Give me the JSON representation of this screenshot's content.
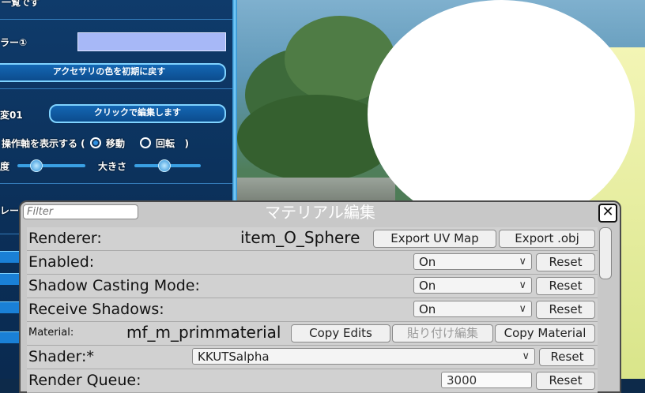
{
  "left_panel": {
    "top_label": "一覧です",
    "color_label": "ラー①",
    "reset_accessory_button": "アクセサリの色を初期に戻す",
    "edit_label": "変01",
    "edit_button": "クリックで編集します",
    "show_axis_label": "操作軸を表示する (",
    "move_label": "移動",
    "rotate_label": "回転",
    "close_paren": ")",
    "speed_label": "度",
    "size_label": "大きさ",
    "row_label": "レー",
    "swatch_color": "#a7b8f7"
  },
  "editor": {
    "title": "マテリアル編集",
    "filter_placeholder": "Filter",
    "close_glyph": "✕",
    "renderer_label": "Renderer:",
    "renderer_value": "item_O_Sphere",
    "export_uv": "Export UV Map",
    "export_obj": "Export .obj",
    "enabled_label": "Enabled:",
    "enabled_value": "On",
    "shadow_cast_label": "Shadow Casting Mode:",
    "shadow_cast_value": "On",
    "receive_label": "Receive Shadows:",
    "receive_value": "On",
    "material_label": "Material:",
    "material_value": "mf_m_primmaterial",
    "copy_edits": "Copy Edits",
    "paste_edits": "貼り付け編集",
    "copy_material": "Copy Material",
    "shader_label": "Shader:*",
    "shader_value": "KKUTSalpha",
    "queue_label": "Render Queue:",
    "queue_value": "3000",
    "reset": "Reset",
    "chevron": "∨"
  }
}
